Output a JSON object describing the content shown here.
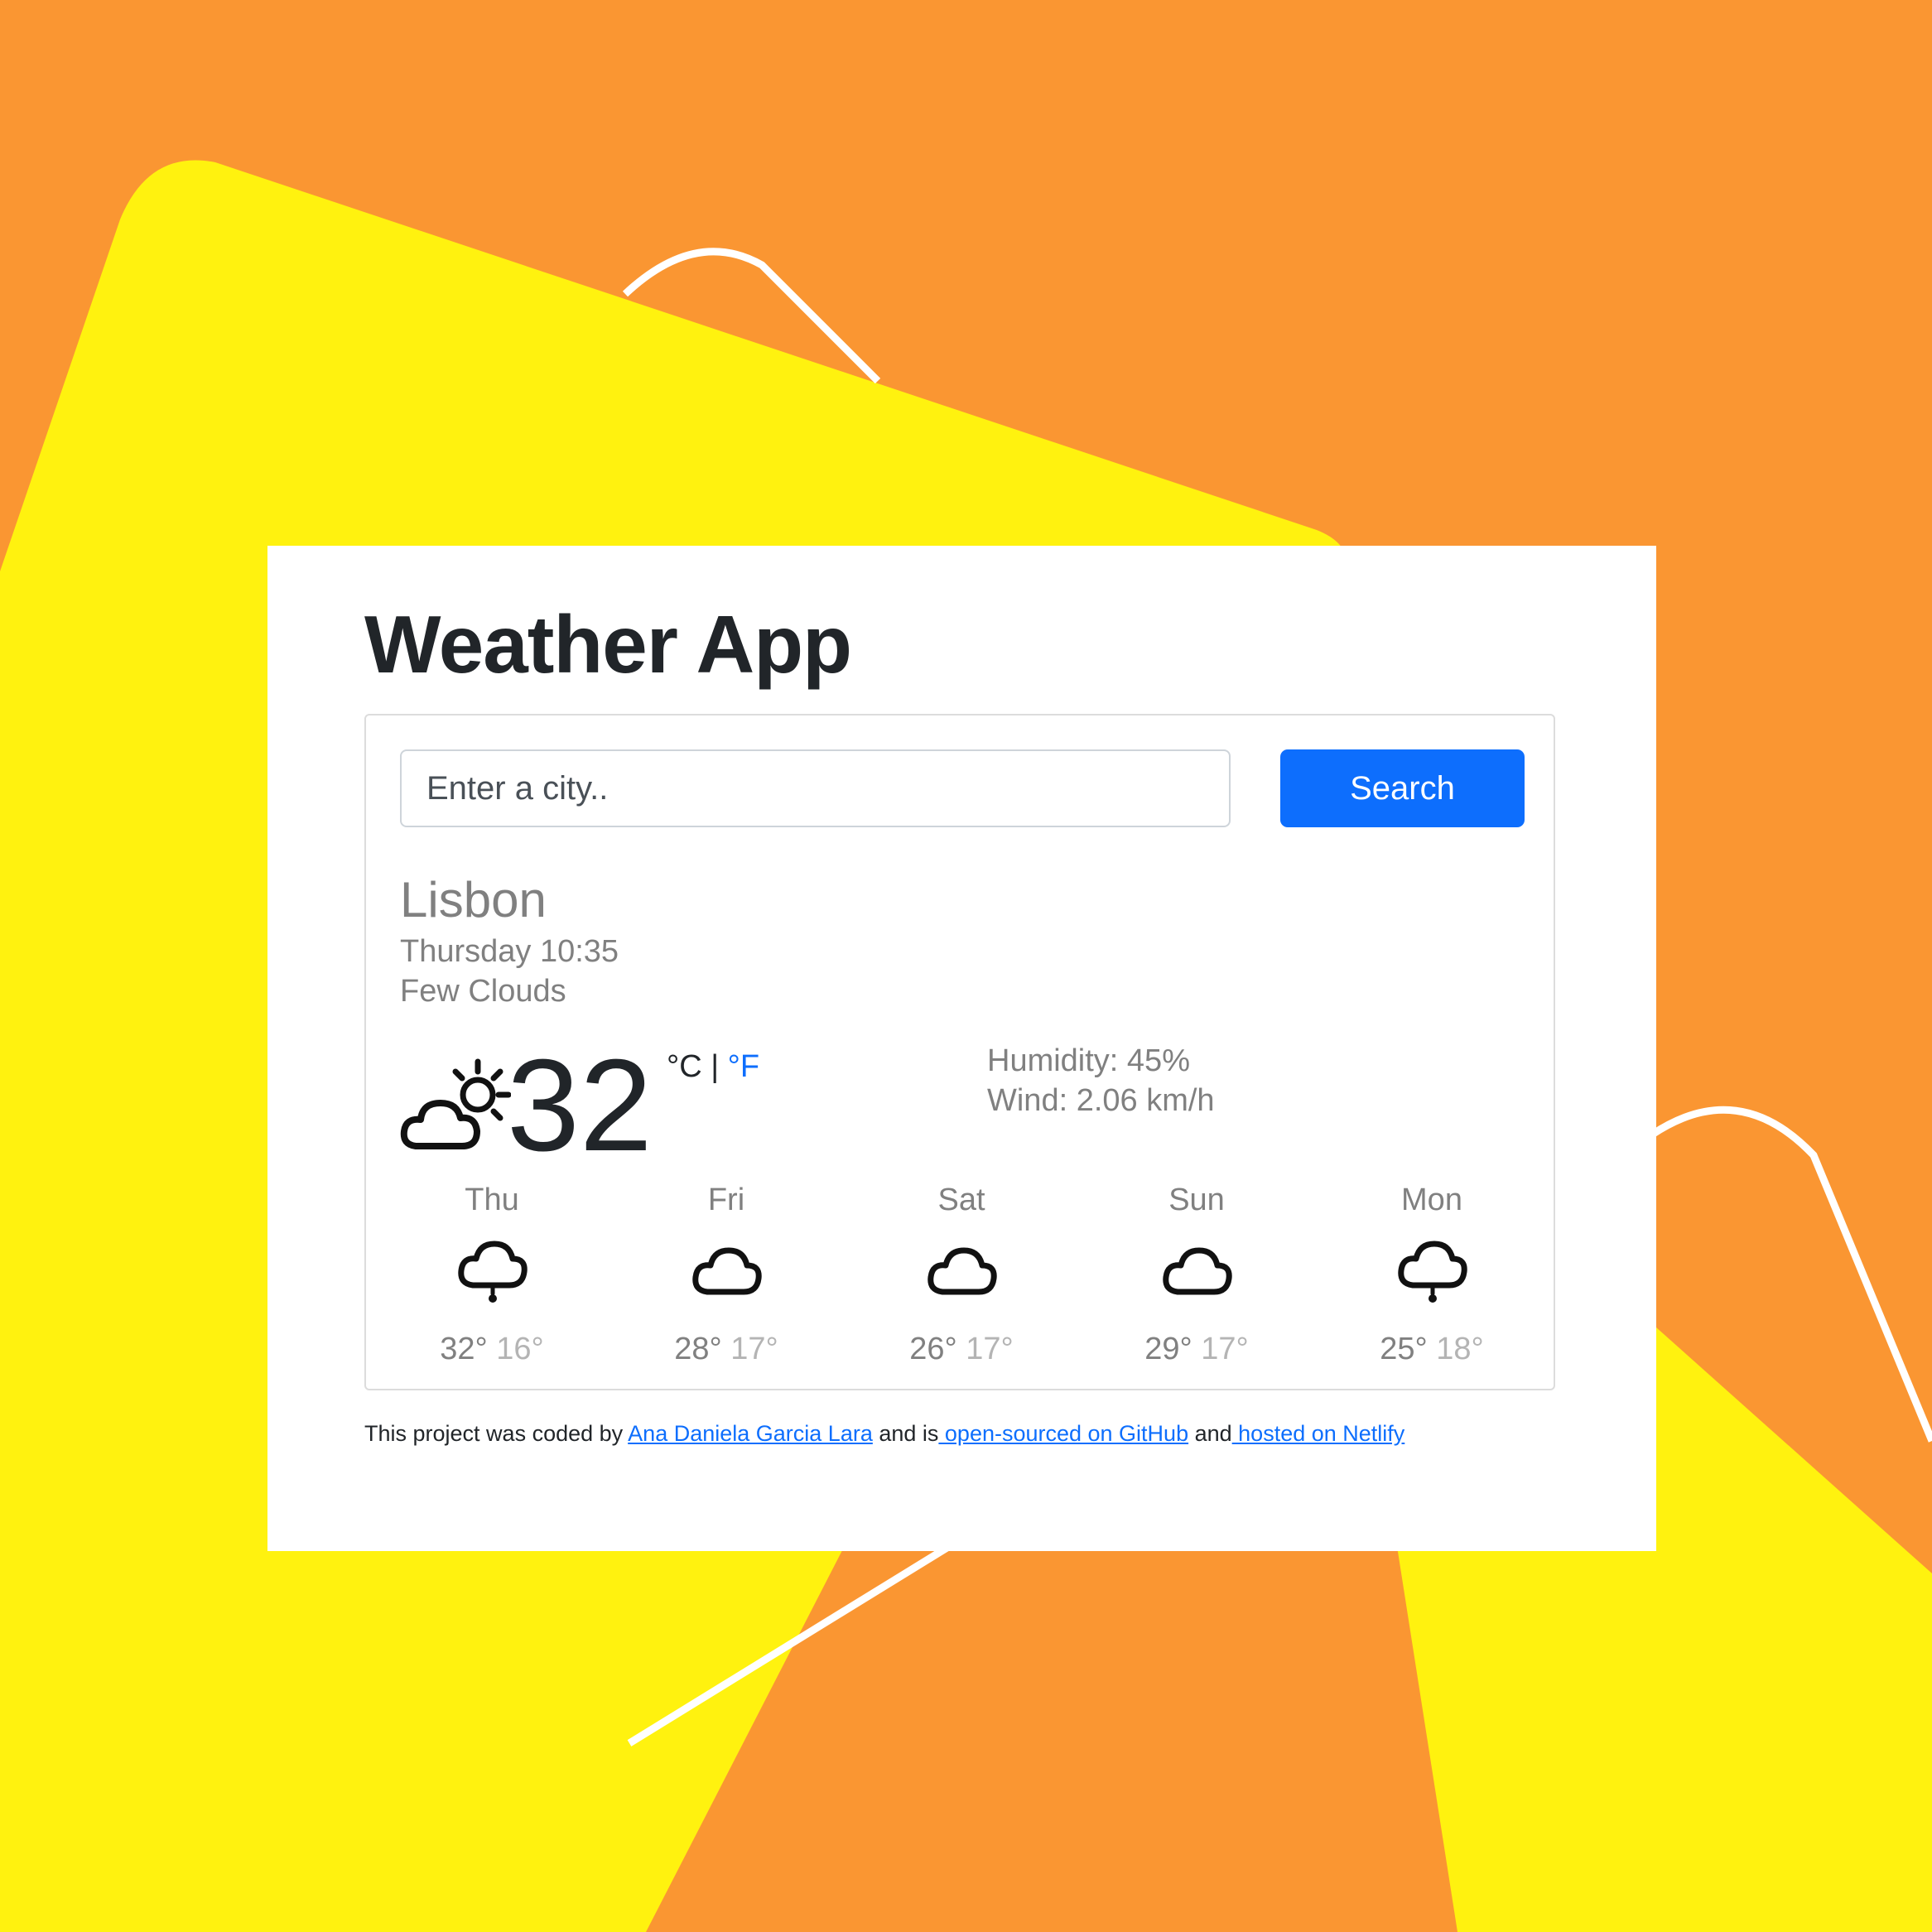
{
  "app": {
    "title": "Weather App"
  },
  "search": {
    "placeholder": "Enter a city..",
    "button_label": "Search"
  },
  "current": {
    "city": "Lisbon",
    "datetime": "Thursday 10:35",
    "description": "Few Clouds",
    "icon": "partly-cloudy-icon",
    "temperature": "32",
    "unit_celsius": "°C",
    "unit_separator": "|",
    "unit_fahrenheit": "°F",
    "humidity": "Humidity: 45%",
    "wind": "Wind: 2.06 km/h"
  },
  "forecast": [
    {
      "day": "Thu",
      "icon": "rain-cloud-icon",
      "max": "32°",
      "min": "16°"
    },
    {
      "day": "Fri",
      "icon": "cloud-icon",
      "max": "28°",
      "min": "17°"
    },
    {
      "day": "Sat",
      "icon": "cloud-icon",
      "max": "26°",
      "min": "17°"
    },
    {
      "day": "Sun",
      "icon": "cloud-icon",
      "max": "29°",
      "min": "17°"
    },
    {
      "day": "Mon",
      "icon": "rain-cloud-icon",
      "max": "25°",
      "min": "18°"
    }
  ],
  "footer": {
    "prefix": "This project was coded by ",
    "author": "Ana Daniela Garcia Lara",
    "middle": " and is",
    "github": " open-sourced on GitHub",
    "and": " and",
    "netlify": " hosted on Netlify"
  },
  "colors": {
    "background_orange": "#FA9632",
    "background_yellow": "#FFF20F",
    "accent_blue": "#0d6efd"
  }
}
